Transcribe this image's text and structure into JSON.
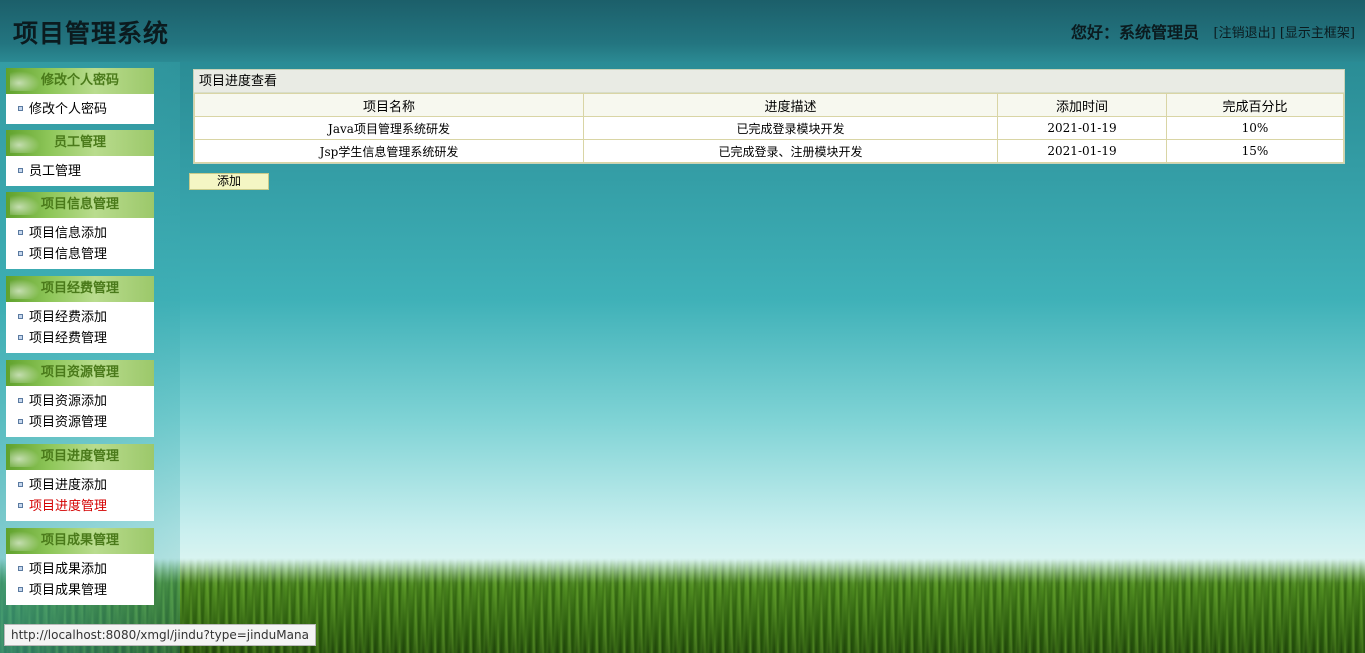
{
  "header": {
    "app_title": "项目管理系统",
    "greeting": "您好：系统管理员",
    "logout_link": "[注销退出]",
    "show_frame_link": "[显示主框架]"
  },
  "sidebar": {
    "groups": [
      {
        "title": "修改个人密码",
        "items": [
          {
            "label": "修改个人密码"
          }
        ]
      },
      {
        "title": "员工管理",
        "items": [
          {
            "label": "员工管理"
          }
        ]
      },
      {
        "title": "项目信息管理",
        "items": [
          {
            "label": "项目信息添加"
          },
          {
            "label": "项目信息管理"
          }
        ]
      },
      {
        "title": "项目经费管理",
        "items": [
          {
            "label": "项目经费添加"
          },
          {
            "label": "项目经费管理"
          }
        ]
      },
      {
        "title": "项目资源管理",
        "items": [
          {
            "label": "项目资源添加"
          },
          {
            "label": "项目资源管理"
          }
        ]
      },
      {
        "title": "项目进度管理",
        "items": [
          {
            "label": "项目进度添加"
          },
          {
            "label": "项目进度管理",
            "active": true
          }
        ]
      },
      {
        "title": "项目成果管理",
        "items": [
          {
            "label": "项目成果添加"
          },
          {
            "label": "项目成果管理"
          }
        ]
      }
    ],
    "active_color": "#d40000"
  },
  "main": {
    "panel_title": "项目进度查看",
    "columns": [
      "项目名称",
      "进度描述",
      "添加时间",
      "完成百分比"
    ],
    "rows": [
      [
        "Java项目管理系统研发",
        "已完成登录模块开发",
        "2021-01-19",
        "10%"
      ],
      [
        "Jsp学生信息管理系统研发",
        "已完成登录、注册模块开发",
        "2021-01-19",
        "15%"
      ]
    ],
    "add_button": "添加"
  },
  "status_bar": {
    "url": "http://localhost:8080/xmgl/jindu?type=jinduMana"
  }
}
